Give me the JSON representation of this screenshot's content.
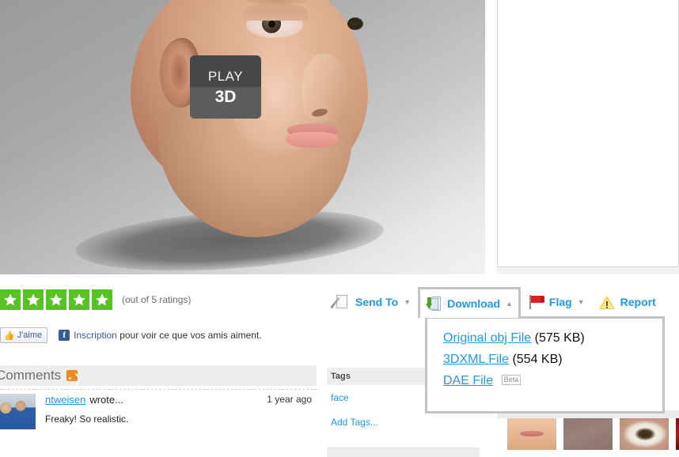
{
  "viewer": {
    "play_button": {
      "line1": "PLAY",
      "line2": "3D"
    }
  },
  "rating": {
    "stars_filled": 5,
    "stars_total": 5,
    "note": "(out of 5 ratings)",
    "star_color": "#56c224"
  },
  "facebook": {
    "like_label": "J'aime",
    "thumb_icon": "thumbs-up-icon",
    "f_glyph": "f",
    "signup_link": "Inscription",
    "signup_rest": " pour voir ce que vos amis aiment.",
    "brand_color": "#3b5998"
  },
  "toolbar": {
    "accent_color": "#1c9ae8",
    "items": [
      {
        "label": "Send To",
        "icon": "send-to-icon",
        "caret": "▼",
        "active": false
      },
      {
        "label": "Download",
        "icon": "download-icon",
        "caret": "▲",
        "active": true
      },
      {
        "label": "Flag",
        "icon": "flag-icon",
        "caret": "▼",
        "active": false
      },
      {
        "label": "Report",
        "icon": "warning-icon",
        "caret": "",
        "active": false
      }
    ]
  },
  "download_menu": {
    "open": true,
    "files": [
      {
        "name": "Original obj File",
        "size": "(575 KB)",
        "badge": ""
      },
      {
        "name": "3DXML File",
        "size": "(554 KB)",
        "badge": ""
      },
      {
        "name": "DAE File",
        "size": "",
        "badge": "Beta"
      }
    ]
  },
  "comments": {
    "heading": "Comments",
    "rss_icon": "rss-icon",
    "entries": [
      {
        "author": "ntweisen",
        "wrote_label": "wrote...",
        "time": "1 year ago",
        "text": "Freaky! So realistic."
      }
    ]
  },
  "tags": {
    "heading": "Tags",
    "items": [
      "face"
    ],
    "add_label": "Add Tags..."
  },
  "thumbnails": {
    "items": [
      "thumbnail-mouth",
      "thumbnail-skin",
      "thumbnail-eye",
      "thumbnail-red-partial"
    ]
  }
}
